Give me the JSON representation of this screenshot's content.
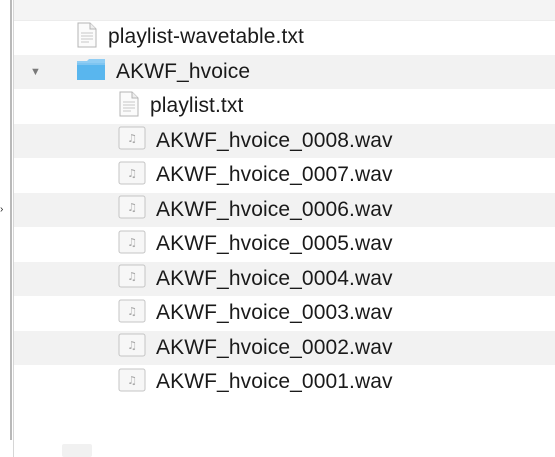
{
  "file_list": {
    "rows": [
      {
        "name": "playlist-wavetable.txt",
        "type": "text-file",
        "icon": "text-file-icon"
      },
      {
        "name": "AKWF_hvoice",
        "type": "folder",
        "icon": "folder-icon",
        "expanded": true
      },
      {
        "name": "playlist.txt",
        "type": "text-file",
        "icon": "text-file-icon"
      },
      {
        "name": "AKWF_hvoice_0008.wav",
        "type": "audio-file",
        "icon": "audio-file-icon"
      },
      {
        "name": "AKWF_hvoice_0007.wav",
        "type": "audio-file",
        "icon": "audio-file-icon"
      },
      {
        "name": "AKWF_hvoice_0006.wav",
        "type": "audio-file",
        "icon": "audio-file-icon"
      },
      {
        "name": "AKWF_hvoice_0005.wav",
        "type": "audio-file",
        "icon": "audio-file-icon"
      },
      {
        "name": "AKWF_hvoice_0004.wav",
        "type": "audio-file",
        "icon": "audio-file-icon"
      },
      {
        "name": "AKWF_hvoice_0003.wav",
        "type": "audio-file",
        "icon": "audio-file-icon"
      },
      {
        "name": "AKWF_hvoice_0002.wav",
        "type": "audio-file",
        "icon": "audio-file-icon"
      },
      {
        "name": "AKWF_hvoice_0001.wav",
        "type": "audio-file",
        "icon": "audio-file-icon"
      }
    ]
  },
  "colors": {
    "folder_blue": "#59b6ee",
    "alt_row": "#f2f2f2",
    "text": "#1a1a1a"
  }
}
